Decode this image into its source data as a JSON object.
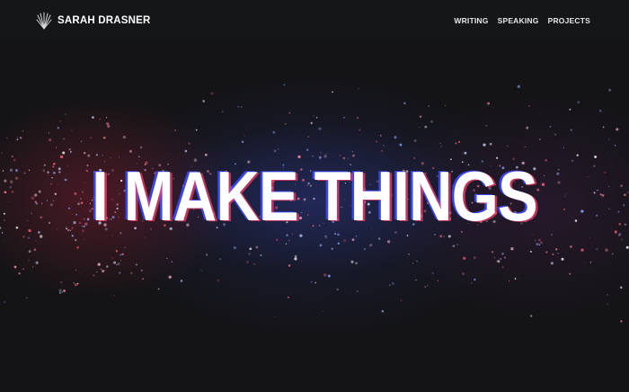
{
  "header": {
    "brand": "SARAH DRASNER",
    "logo_icon": "fan-logo-icon",
    "nav": [
      {
        "label": "WRITING"
      },
      {
        "label": "SPEAKING"
      },
      {
        "label": "PROJECTS"
      }
    ]
  },
  "hero": {
    "headline": "I MAKE THINGS",
    "colors": {
      "background": "#141416",
      "headline": "#ffffff",
      "glitch_blue": "#3b4cff",
      "glitch_red": "#ff3f6b"
    }
  }
}
